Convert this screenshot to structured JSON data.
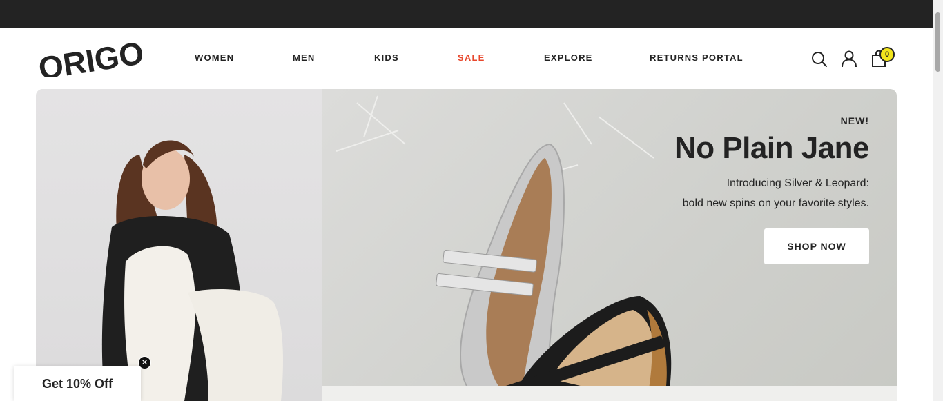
{
  "brand": {
    "logo_text": "ORIGO"
  },
  "nav": {
    "items": [
      {
        "label": "WOMEN"
      },
      {
        "label": "MEN"
      },
      {
        "label": "KIDS"
      },
      {
        "label": "SALE"
      },
      {
        "label": "EXPLORE"
      },
      {
        "label": "RETURNS PORTAL"
      }
    ]
  },
  "header_icons": {
    "search": "search-icon",
    "account": "user-icon",
    "cart": "shopping-bag-icon",
    "cart_count": "0"
  },
  "hero": {
    "eyebrow": "NEW!",
    "headline": "No Plain Jane",
    "sub_line_1": "Introducing Silver & Leopard:",
    "sub_line_2": "bold new spins on your favorite styles.",
    "cta": "SHOP NOW",
    "images": [
      "model-photo",
      "silver-mary-jane-shoe",
      "leopard-mary-jane-shoe"
    ]
  },
  "promo": {
    "label": "Get 10% Off",
    "close": "✕"
  },
  "colors": {
    "topbar": "#232323",
    "sale": "#e8472c",
    "badge": "#f2e51c",
    "text": "#232323"
  }
}
